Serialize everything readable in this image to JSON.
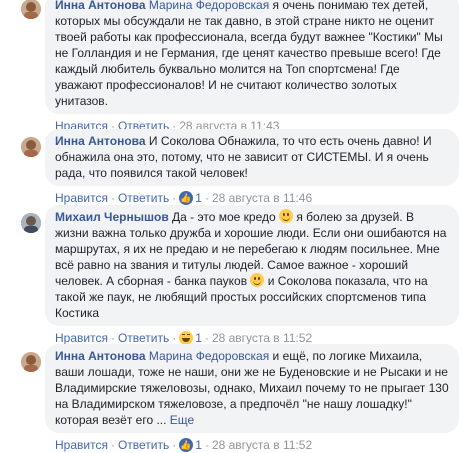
{
  "comments": [
    {
      "author": "Инна Антонова",
      "mention": "Марина Федоровская",
      "text": " я очень понимаю тех детей, которых мы обсуждали не так давно, в этой стране никто не оценит твоей работы как профессионала, всегда будут важнее \"Костики\" Мы не Голландия и не Германия, где ценят качество превыше всего! Где каждый любитель буквально молится на Топ спортсмена! Где уважают профессионалов! И не считают количество золотых унитазов.",
      "reply_label": "Ответить",
      "like_label": "Нравится",
      "date": "28 августа в 11:43",
      "reaction_count": ""
    },
    {
      "author": "Инна Антонова",
      "mention": "",
      "text": " И Соколова Обнажила, то что есть очень давно! И обнажила она это, потому, что не зависит от СИСТЕМЫ. И я очень рада, что появился такой человек!",
      "reply_label": "Ответить",
      "like_label": "Нравится",
      "date": "28 августа в 11:46",
      "reaction_count": "1"
    },
    {
      "author": "Михаил Чернышов",
      "mention": "",
      "text_a": " Да - это мое кредо ",
      "text_b": " я болею за друзей. В жизни важна только дружба и хорошие люди. Если они ошибаются на маршрутах, я их не предаю и не перебегаю к людям посильнее. Мне всё равно на звания и титулы людей. Самое важное - хороший человек. А сборная - банка пауков ",
      "text_c": " и Соколова показала, что на такой же паук, не любящий простых российских спортсменов типа Костика",
      "reply_label": "Ответить",
      "like_label": "Нравится",
      "date": "28 августа в 11:52",
      "reaction_count": "1"
    },
    {
      "author": "Инна Антонова",
      "mention": "Марина Федоровская",
      "text": " и ещё, по логике Михаила, ваши лошади, тоже не наши, они же не Буденовские и не Рысаки и не Владимирские тяжеловозы, однако, Михаил почему то не прыгает 130 на Владимирском тяжеловозе, а предпочёл \"не нашу лошадку!\" которая везёт его ... ",
      "more_label": "Еще",
      "reply_label": "Ответить",
      "like_label": "Нравится",
      "date": "28 августа в 11:52",
      "reaction_count": "1"
    }
  ],
  "colors": {
    "link": "#385898",
    "bubble": "#f2f3f5",
    "meta": "#90949c"
  },
  "icons": [
    "avatar-inna",
    "avatar-mikhail",
    "like-reaction-icon",
    "haha-reaction-icon",
    "smile-emoji-icon"
  ]
}
